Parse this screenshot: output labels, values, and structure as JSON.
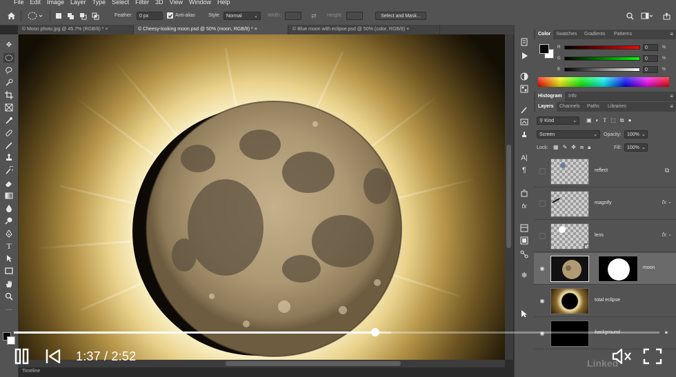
{
  "menu": [
    "File",
    "Edit",
    "Image",
    "Layer",
    "Type",
    "Select",
    "Filter",
    "3D",
    "View",
    "Window",
    "Help"
  ],
  "options": {
    "feather_label": "Feather:",
    "feather_value": "0 px",
    "antialias_label": "Anti-alias",
    "style_label": "Style:",
    "style_value": "Normal",
    "width_label": "Width:",
    "height_label": "Height:",
    "select_mask_label": "Select and Mask..."
  },
  "tabs": [
    {
      "label": "© Moon photo.jpg @ 45.7% (RGB/8) *"
    },
    {
      "label": "© Cheesy-looking moon.psd @ 50% (moon, RGB/8) *"
    },
    {
      "label": "© Blue moon with eclipse.psd @ 50% (color, RGB/8)"
    }
  ],
  "color_panel": {
    "tabs": [
      "Color",
      "Swatches",
      "Gradients",
      "Patterns"
    ],
    "channels": [
      {
        "label": "R",
        "value": "0"
      },
      {
        "label": "G",
        "value": "0"
      },
      {
        "label": "B",
        "value": "0"
      }
    ],
    "foreground": "#000000",
    "background": "#ffffff"
  },
  "histogram_panel": {
    "tabs": [
      "Histogram",
      "Info"
    ]
  },
  "layers_panel": {
    "tabs": [
      "Layers",
      "Channels",
      "Paths",
      "Libraries"
    ],
    "filter_label": "Kind",
    "blend_mode": "Screen",
    "opacity_label": "Opacity:",
    "opacity_value": "100%",
    "lock_label": "Lock:",
    "fill_label": "Fill:",
    "fill_value": "100%",
    "layers": [
      {
        "name": "reflect",
        "visible": false,
        "fx": ""
      },
      {
        "name": "magnify",
        "visible": false,
        "fx": "fx"
      },
      {
        "name": "lens",
        "visible": false,
        "fx": "fx"
      },
      {
        "name": "moon",
        "visible": true,
        "fx": ""
      },
      {
        "name": "total eclipse",
        "visible": true,
        "fx": ""
      },
      {
        "name": "background",
        "visible": true,
        "fx": ""
      }
    ]
  },
  "timeline_label": "Timeline",
  "player": {
    "current_time": "1:37",
    "separator": " / ",
    "duration": "2:52",
    "progress": 0.5598,
    "buffered": 0.5845,
    "watermark": "Linked"
  },
  "icons": [
    "home-icon",
    "marquee-tool-icon",
    "search-icon",
    "play-pause-icon",
    "back-icon",
    "volume-icon",
    "fullscreen-icon",
    "eye-icon",
    "fx-icon"
  ]
}
